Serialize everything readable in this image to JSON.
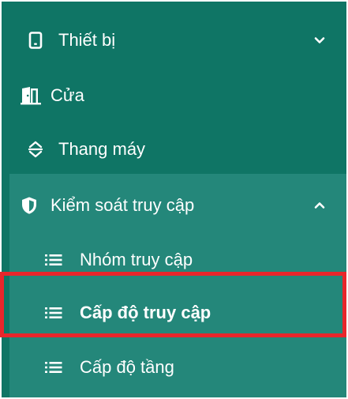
{
  "colors": {
    "sidebar_bg": "#0f7565",
    "submenu_bg": "#24877a",
    "text": "#ffffff",
    "highlight_border": "#e8262b"
  },
  "menu": {
    "devices": {
      "label": "Thiết bị",
      "icon": "tablet-icon",
      "expanded": false
    },
    "doors": {
      "label": "Cửa",
      "icon": "door-icon"
    },
    "elevator": {
      "label": "Thang máy",
      "icon": "elevator-arrows-icon"
    },
    "access_control": {
      "label": "Kiểm soát truy cập",
      "icon": "shield-icon",
      "expanded": true,
      "items": [
        {
          "label": "Nhóm truy cập",
          "icon": "list-icon",
          "active": false
        },
        {
          "label": "Cấp độ truy cập",
          "icon": "list-icon",
          "active": true
        },
        {
          "label": "Cấp độ tầng",
          "icon": "list-icon",
          "active": false
        }
      ]
    }
  }
}
